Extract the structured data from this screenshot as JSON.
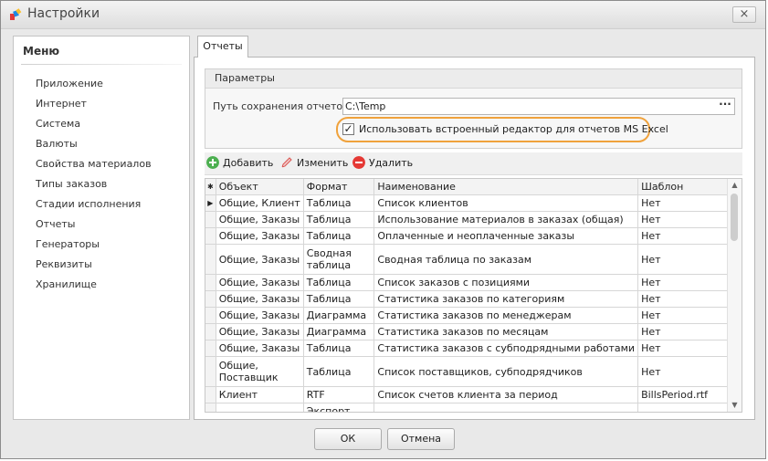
{
  "window": {
    "title": "Настройки",
    "close_glyph": "×"
  },
  "menu": {
    "title": "Меню",
    "items": [
      "Приложение",
      "Интернет",
      "Система",
      "Валюты",
      "Свойства материалов",
      "Типы заказов",
      "Стадии исполнения",
      "Отчеты",
      "Генераторы",
      "Реквизиты",
      "Хранилище"
    ]
  },
  "tab": {
    "label": "Отчеты"
  },
  "params": {
    "title": "Параметры",
    "path_label": "Путь сохранения отчетов:",
    "path_value": "C:\\Temp",
    "browse_label": "···",
    "checkbox_label": "Использовать встроенный редактор для отчетов MS Excel",
    "checkbox_checked": true,
    "check_glyph": "✓"
  },
  "toolbar": {
    "add": "Добавить",
    "edit": "Изменить",
    "delete": "Удалить"
  },
  "grid": {
    "indicator_header": "✱",
    "row_indicator": "▶",
    "columns": [
      "Объект",
      "Формат",
      "Наименование",
      "Шаблон"
    ],
    "rows": [
      [
        "Общие, Клиент",
        "Таблица",
        "Список клиентов",
        "Нет"
      ],
      [
        "Общие, Заказы",
        "Таблица",
        "Использование материалов в заказах (общая)",
        "Нет"
      ],
      [
        "Общие, Заказы",
        "Таблица",
        "Оплаченные и неоплаченные заказы",
        "Нет"
      ],
      [
        "Общие, Заказы",
        "Сводная таблица",
        "Сводная таблица по заказам",
        "Нет"
      ],
      [
        "Общие, Заказы",
        "Таблица",
        "Список заказов с позициями",
        "Нет"
      ],
      [
        "Общие, Заказы",
        "Таблица",
        "Статистика заказов по категориям",
        "Нет"
      ],
      [
        "Общие, Заказы",
        "Диаграмма",
        "Статистика заказов по менеджерам",
        "Нет"
      ],
      [
        "Общие, Заказы",
        "Диаграмма",
        "Статистика заказов по месяцам",
        "Нет"
      ],
      [
        "Общие, Заказы",
        "Таблица",
        "Статистика заказов с субподрядными работами",
        "Нет"
      ],
      [
        "Общие, Поставщик",
        "Таблица",
        "Список поставщиков, субподрядчиков",
        "Нет"
      ],
      [
        "Клиент",
        "RTF",
        "Список счетов клиента за период",
        "BillsPeriod.rtf"
      ],
      [
        "",
        "Экспорт",
        "",
        ""
      ]
    ],
    "scroll_up": "▲",
    "scroll_down": "▼"
  },
  "buttons": {
    "ok": "ОК",
    "cancel": "Отмена"
  },
  "colors": {
    "highlight": "#f0a23c",
    "add_icon": "#4caf50",
    "delete_icon": "#e53935",
    "edit_icon": "#d9534f"
  }
}
